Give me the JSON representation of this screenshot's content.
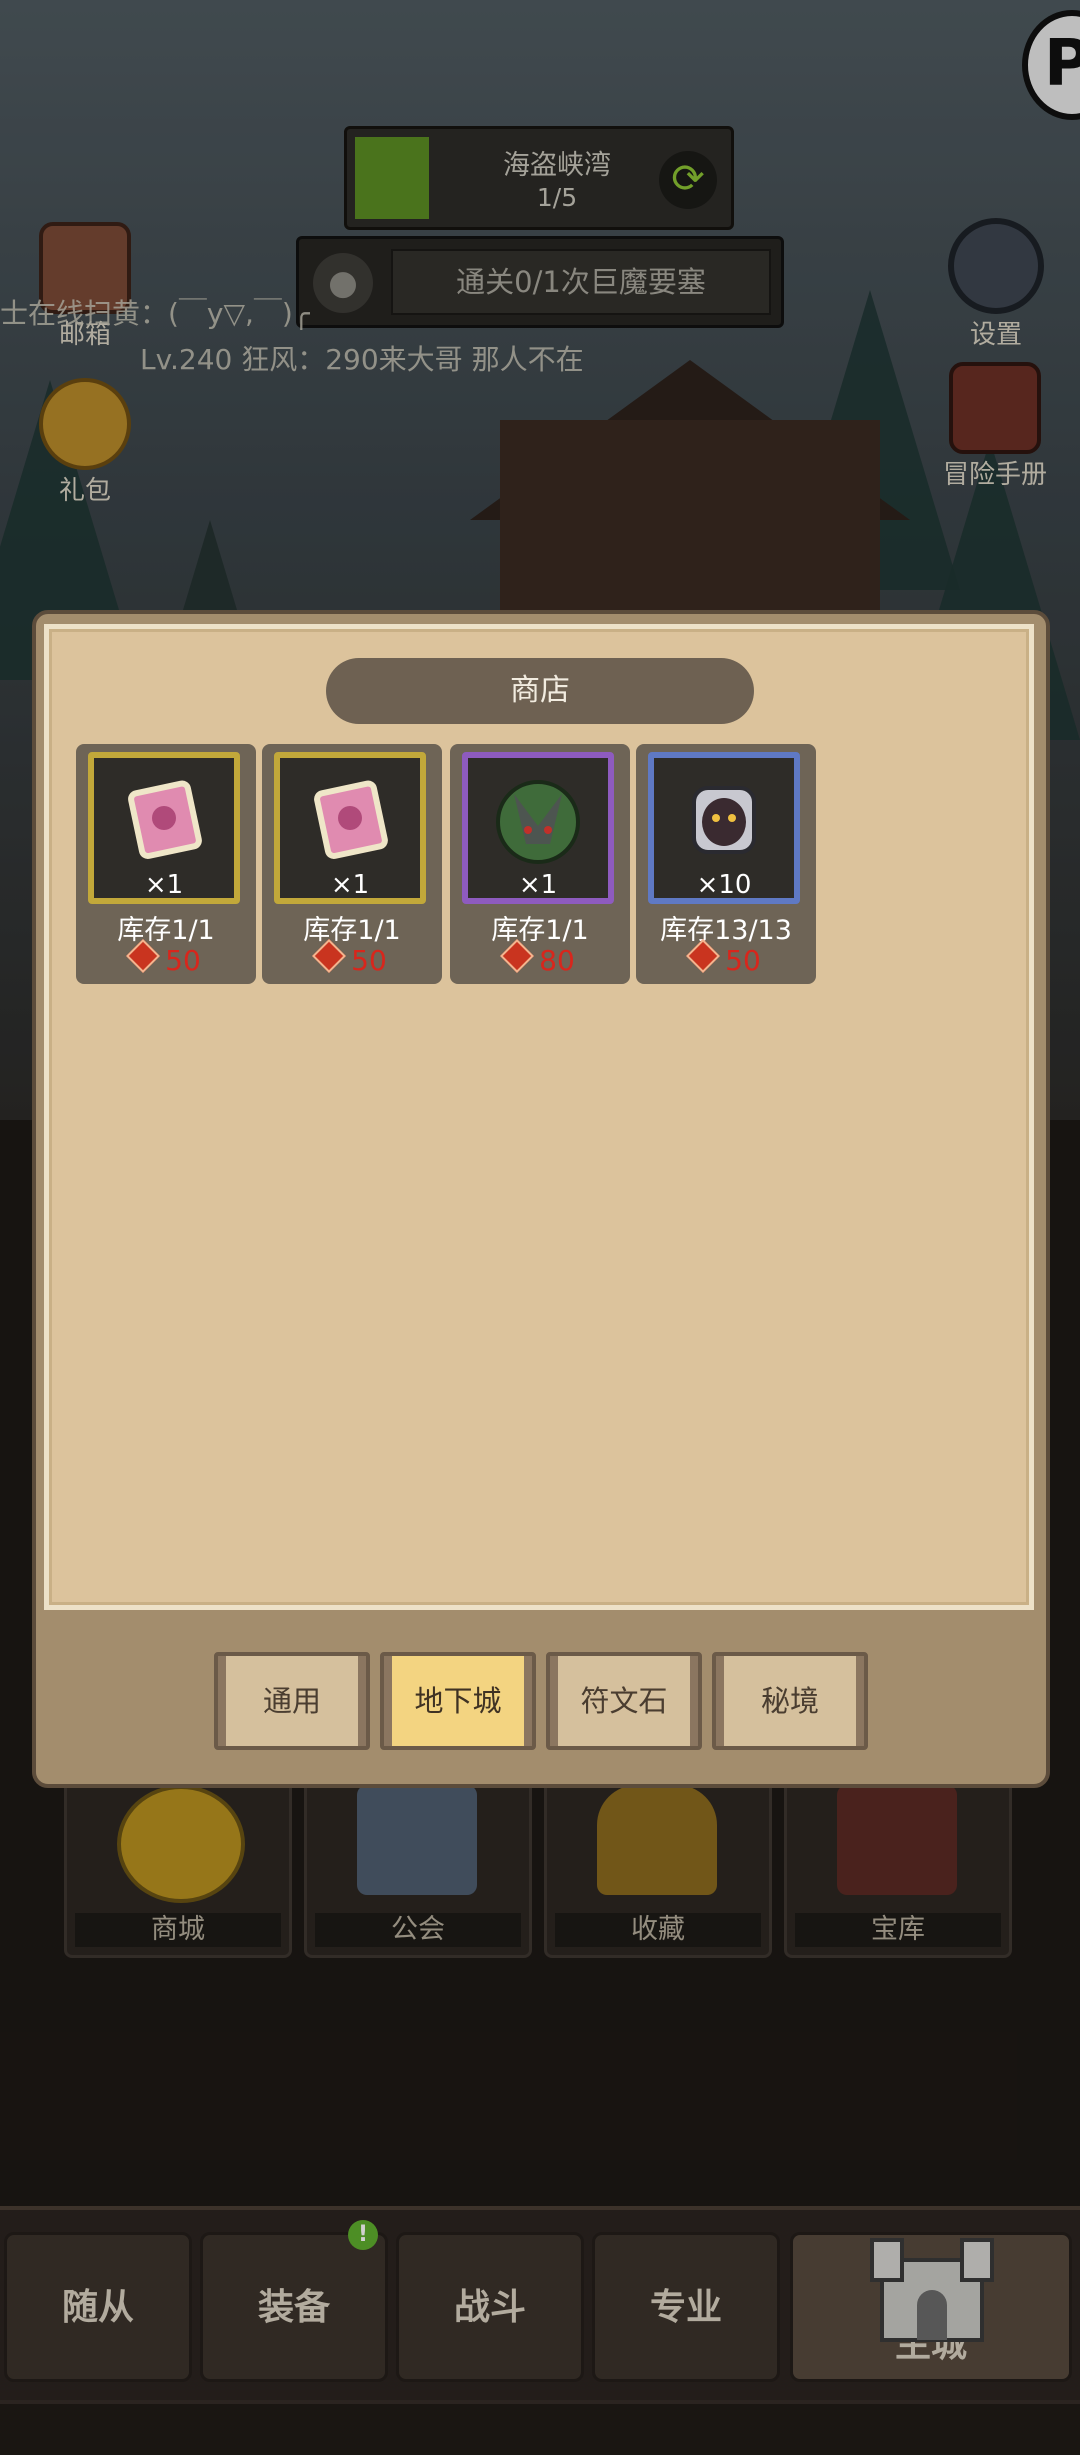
{
  "hud": {
    "stage_name": "海盗峡湾",
    "stage_progress": "1/5",
    "quest_text": "通关0/1次巨魔要塞",
    "chat_line_1": "士在线扫黄：(￣y▽,￣)╭",
    "chat_line_2": "Lv.240 狂风：290来大哥   那人不在"
  },
  "side_buttons": {
    "mail_label": "邮箱",
    "gift_label": "礼包",
    "settings_label": "设置",
    "handbook_label": "冒险手册"
  },
  "shop": {
    "title": "商店",
    "items": [
      {
        "qty": "×1",
        "stock": "库存1/1",
        "price": "50",
        "rarity": "gold",
        "icon": "pink-book-icon"
      },
      {
        "qty": "×1",
        "stock": "库存1/1",
        "price": "50",
        "rarity": "gold",
        "icon": "pink-book-icon"
      },
      {
        "qty": "×1",
        "stock": "库存1/1",
        "price": "80",
        "rarity": "purple",
        "icon": "green-monster-icon"
      },
      {
        "qty": "×10",
        "stock": "库存13/13",
        "price": "50",
        "rarity": "blue",
        "icon": "dark-monster-icon"
      }
    ],
    "tabs": [
      "通用",
      "地下城",
      "符文石",
      "秘境"
    ],
    "active_tab": "地下城"
  },
  "city": {
    "buildings": [
      "商城",
      "公会",
      "收藏",
      "宝库"
    ]
  },
  "bottom_nav": {
    "tabs": [
      "随从",
      "装备",
      "战斗",
      "专业",
      "主城"
    ],
    "active": "主城",
    "equip_badge": "!"
  },
  "colors": {
    "gold_frame": "#c2a83a",
    "purple_frame": "#8e5bbf",
    "blue_frame": "#5f79c4",
    "price_red": "#d8261c",
    "active_tab": "#f3d481"
  }
}
